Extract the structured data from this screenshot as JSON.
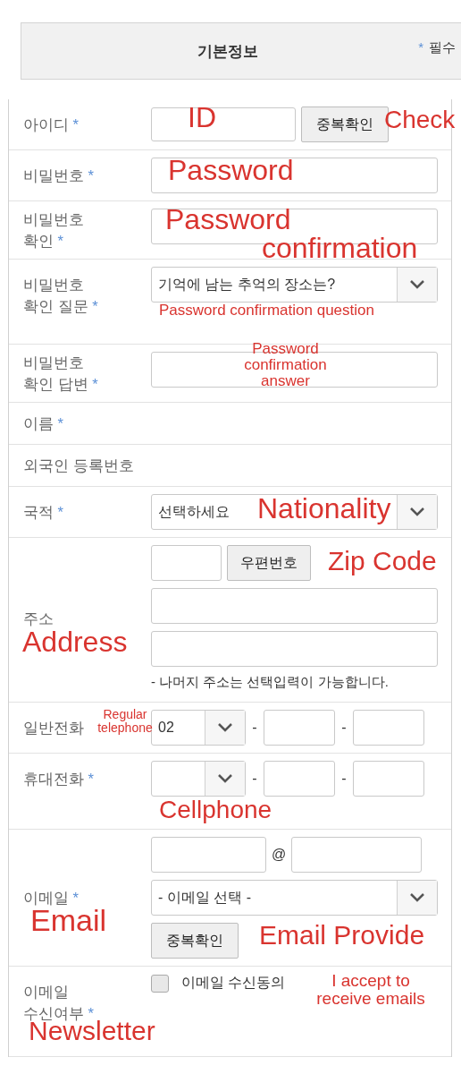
{
  "header": {
    "title": "기본정보",
    "required_mark": "*",
    "required_label": "필수"
  },
  "rows": [
    {
      "kind": "id",
      "label": [
        "아이디"
      ],
      "required": true,
      "button": "중복확인",
      "notes": [
        "ID",
        "Check"
      ]
    },
    {
      "kind": "input",
      "label": [
        "비밀번호"
      ],
      "required": true,
      "notes": [
        "Password"
      ]
    },
    {
      "kind": "input",
      "label": [
        "비밀번호",
        "확인"
      ],
      "required": true,
      "notes": [
        "Password",
        "confirmation"
      ]
    },
    {
      "kind": "select",
      "label": [
        "비밀번호",
        "확인 질문"
      ],
      "required": true,
      "value": "기억에 남는 추억의 장소는?",
      "notes": [
        "Password confirmation question"
      ]
    },
    {
      "kind": "input",
      "label": [
        "비밀번호",
        "확인 답변"
      ],
      "required": true,
      "notes": [
        "Password confirmation answer"
      ]
    },
    {
      "kind": "empty",
      "label": [
        "이름"
      ],
      "required": true
    },
    {
      "kind": "empty",
      "label": [
        "외국인 등록번호"
      ],
      "required": false
    },
    {
      "kind": "select",
      "label": [
        "국적"
      ],
      "required": true,
      "value": "선택하세요",
      "notes": [
        "Nationality"
      ]
    },
    {
      "kind": "address",
      "label": [
        "주소"
      ],
      "required": false,
      "button": "우편번호",
      "hint": "- 나머지 주소는 선택입력이 가능합니다.",
      "notes": [
        "Zip Code",
        "Address"
      ]
    },
    {
      "kind": "phone",
      "label": [
        "일반전화"
      ],
      "required": false,
      "value": "02",
      "separators": [
        "-",
        "-"
      ],
      "notes": [
        "Regular telephone"
      ]
    },
    {
      "kind": "phone",
      "label": [
        "휴대전화"
      ],
      "required": true,
      "separators": [
        "-",
        "-"
      ],
      "notes": [
        "Cellphone"
      ]
    },
    {
      "kind": "email",
      "label": [
        "이메일"
      ],
      "required": true,
      "at": "@",
      "select": "- 이메일 선택 -",
      "button": "중복확인",
      "notes": [
        "Email Provide",
        "Email"
      ]
    },
    {
      "kind": "checkbox",
      "label": [
        "이메일",
        "수신여부"
      ],
      "required": true,
      "checked": false,
      "text": "이메일 수신동의",
      "notes": [
        "I accept to receive emails",
        "Newsletter"
      ]
    }
  ]
}
